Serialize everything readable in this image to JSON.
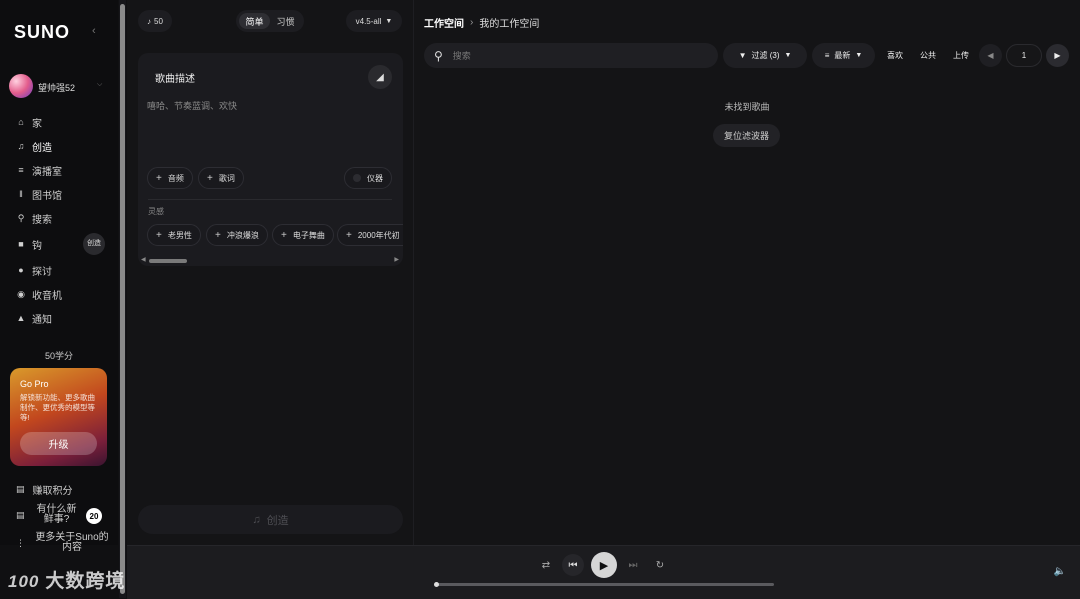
{
  "sidebar": {
    "logo": "SUNO",
    "user": {
      "name": "望帅强52"
    },
    "nav": [
      {
        "label": "家",
        "icon": "home-icon"
      },
      {
        "label": "创造",
        "icon": "music-note-icon",
        "active": true
      },
      {
        "label": "演播室",
        "icon": "studio-icon"
      },
      {
        "label": "图书馆",
        "icon": "library-icon"
      },
      {
        "label": "搜索",
        "icon": "search-icon"
      },
      {
        "label": "钩",
        "icon": "hook-icon"
      },
      {
        "label": "探讨",
        "icon": "compass-icon"
      },
      {
        "label": "收音机",
        "icon": "radio-icon"
      },
      {
        "label": "通知",
        "icon": "bell-icon"
      }
    ],
    "create_fab": "创造",
    "credits": "50学分",
    "gopro": {
      "title": "Go Pro",
      "desc": "解锁新功能、更多歌曲制作、更优秀的模型等等!",
      "button": "升级"
    },
    "bottom": [
      {
        "label": "赚取积分",
        "icon": "gift-icon"
      },
      {
        "label": "有什么新鲜事?",
        "icon": "news-icon",
        "badge": "20"
      },
      {
        "label": "更多关于Suno的内容",
        "icon": "more-icon"
      }
    ]
  },
  "create": {
    "credits_pill": "50",
    "tabs": [
      "简单",
      "习惯"
    ],
    "model": "v4.5-all",
    "card_title": "歌曲描述",
    "placeholder": "嘻哈、节奏蓝调、欢快",
    "chips": [
      "音频",
      "歌词"
    ],
    "instrumental": "仪器",
    "inspiration_label": "灵感",
    "inspiration": [
      "老男性",
      "冲浪爆浪",
      "电子舞曲",
      "2000年代初"
    ],
    "create_button": "创造"
  },
  "workspace": {
    "breadcrumb": [
      "工作空间",
      "我的工作空间"
    ],
    "search_placeholder": "搜索",
    "filter": "过滤 (3)",
    "sort": "最新",
    "favorite": "喜欢",
    "public": "公共",
    "upload": "上传",
    "page": "1",
    "empty_message": "未找到歌曲",
    "reset_button": "复位滤波器"
  },
  "watermark": {
    "logo": "100",
    "text": "大数跨境"
  },
  "colors": {
    "background": "#101012",
    "panel": "#141416",
    "accent_orange": "#d99a2b",
    "accent_red": "#c2471e"
  }
}
